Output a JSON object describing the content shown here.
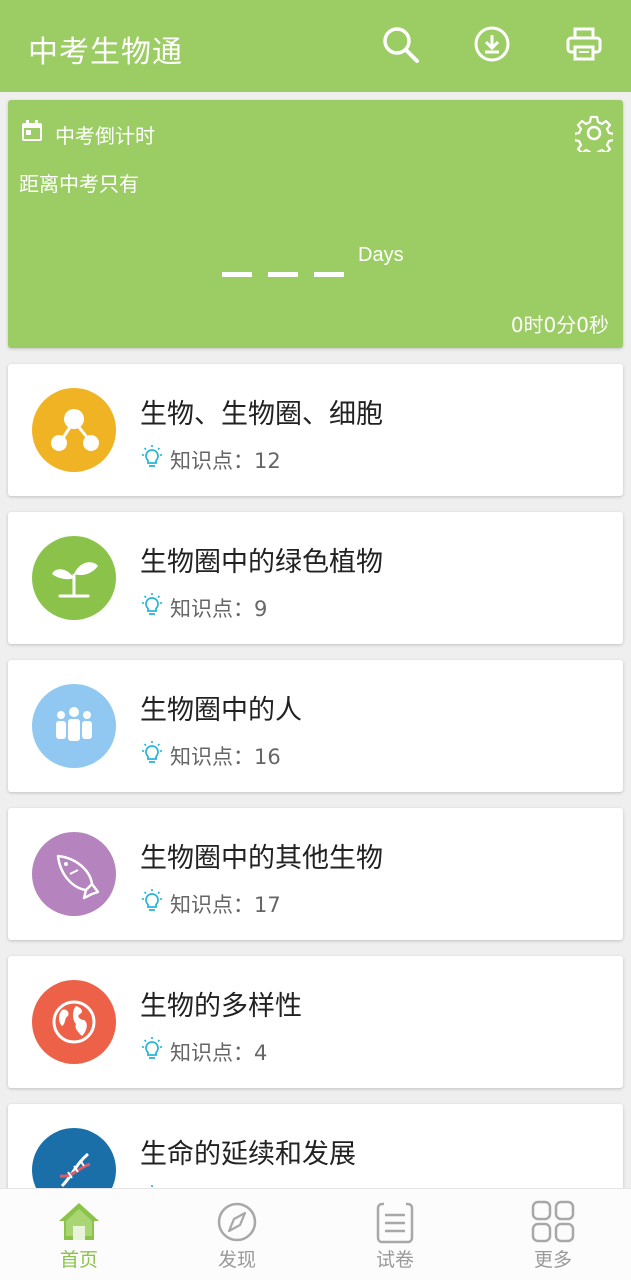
{
  "app": {
    "title": "中考生物通"
  },
  "header_icons": [
    "search-icon",
    "download-icon",
    "print-icon"
  ],
  "countdown": {
    "header": "中考倒计时",
    "subtitle": "距离中考只有",
    "days_value": "_ _ _",
    "days_unit": "Days",
    "timer": "0时0分0秒"
  },
  "chapters": [
    {
      "title": "生物、生物圈、细胞",
      "kp_label": "知识点：12",
      "color": "#f0b323",
      "icon": "molecule-icon"
    },
    {
      "title": "生物圈中的绿色植物",
      "kp_label": "知识点：9",
      "color": "#8bc34a",
      "icon": "sprout-icon"
    },
    {
      "title": "生物圈中的人",
      "kp_label": "知识点：16",
      "color": "#90c8f2",
      "icon": "people-icon"
    },
    {
      "title": "生物圈中的其他生物",
      "kp_label": "知识点：17",
      "color": "#b583be",
      "icon": "fish-icon"
    },
    {
      "title": "生物的多样性",
      "kp_label": "知识点：4",
      "color": "#ec6148",
      "icon": "globe-icon"
    },
    {
      "title": "生命的延续和发展",
      "kp_label": "",
      "color": "#1a6fa8",
      "icon": "dna-icon"
    }
  ],
  "tabs": [
    {
      "label": "首页",
      "icon": "home-icon",
      "active": true
    },
    {
      "label": "发现",
      "icon": "compass-icon",
      "active": false
    },
    {
      "label": "试卷",
      "icon": "paper-icon",
      "active": false
    },
    {
      "label": "更多",
      "icon": "grid-icon",
      "active": false
    }
  ],
  "colors": {
    "primary": "#9ccd65",
    "accent_tab": "#8bc34a",
    "bulb": "#29b6d8"
  }
}
